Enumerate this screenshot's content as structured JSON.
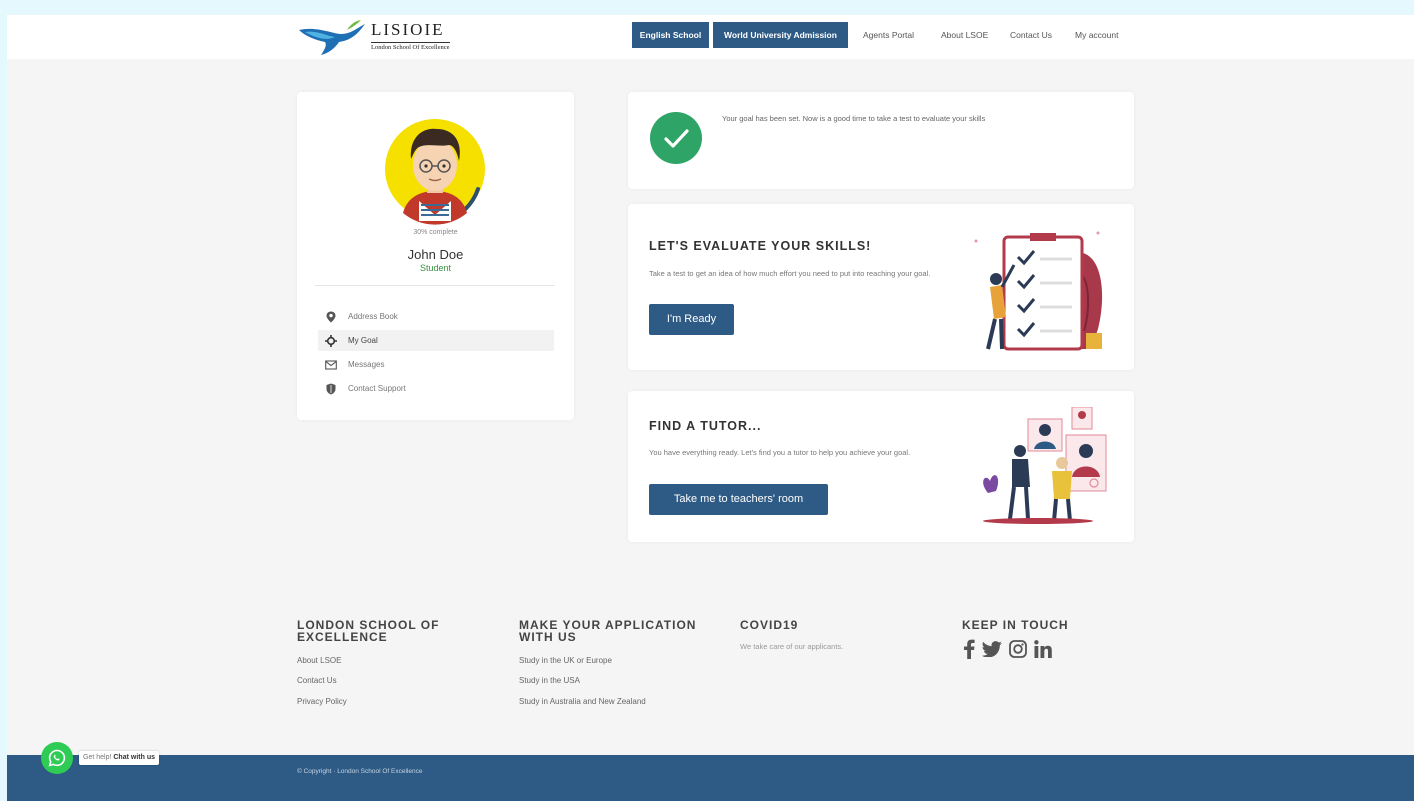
{
  "header": {
    "logo_title": "LISIOIE",
    "logo_subtitle": "London School Of Excellence",
    "nav_buttons": [
      "English School",
      "World University Admission"
    ],
    "nav_links": [
      "Agents Portal",
      "About LSOE",
      "Contact Us",
      "My account"
    ],
    "brand_color": "#2e5b85"
  },
  "profile": {
    "progress_label": "30% complete",
    "progress_fraction": 0.3,
    "name": "John Doe",
    "role": "Student",
    "menu": [
      {
        "label": "Address Book",
        "icon": "map-marker-icon"
      },
      {
        "label": "My Goal",
        "icon": "crosshair-icon",
        "active": true
      },
      {
        "label": "Messages",
        "icon": "envelope-icon"
      },
      {
        "label": "Contact Support",
        "icon": "shield-icon"
      }
    ]
  },
  "goal_card": {
    "message": "Your goal has been set. Now is a good time to take a test to evaluate your skills",
    "icon": "check-circle-icon",
    "accent_color": "#2ea466"
  },
  "evaluate_card": {
    "title": "LET'S EVALUATE YOUR SKILLS!",
    "description": "Take a test to get an idea of how much effort you need to put into reaching your goal.",
    "button": "I'm Ready"
  },
  "tutor_card": {
    "title": "FIND A TUTOR...",
    "description": "You have everything ready. Let's find you a tutor to help you achieve your goal.",
    "button": "Take me to teachers' room"
  },
  "footer": {
    "col1": {
      "title": "LONDON SCHOOL OF EXCELLENCE",
      "links": [
        "About LSOE",
        "Contact Us",
        "Privacy Policy"
      ]
    },
    "col2": {
      "title": "MAKE YOUR APPLICATION WITH US",
      "links": [
        "Study in the UK or Europe",
        "Study in the USA",
        "Study in Australia and New Zealand"
      ]
    },
    "col3": {
      "title": "COVID19",
      "text": "We take care of our applicants."
    },
    "col4": {
      "title": "KEEP IN TOUCH",
      "icons": [
        "facebook-icon",
        "twitter-icon",
        "instagram-icon",
        "linkedin-icon"
      ]
    },
    "copyright": "© Copyright · London School Of Excellence"
  },
  "chat_widget": {
    "label_prefix": "Get help!",
    "label_action": "Chat with us",
    "icon": "whatsapp-icon"
  }
}
